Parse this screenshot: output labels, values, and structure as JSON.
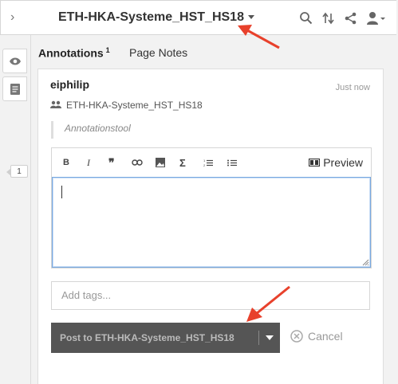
{
  "topbar": {
    "group_title": "ETH-HKA-Systeme_HST_HS18",
    "icons": [
      "search-icon",
      "sort-icon",
      "share-icon",
      "user-icon"
    ]
  },
  "sidebar": {
    "annotation_count": "1",
    "icons": [
      "eye-icon",
      "page-icon"
    ]
  },
  "tabs": {
    "annotations_label": "Annotations",
    "annotations_count": "1",
    "page_notes_label": "Page Notes"
  },
  "annotation": {
    "username": "eiphilip",
    "timestamp": "Just now",
    "group": "ETH-HKA-Systeme_HST_HS18",
    "quote": "Annotationstool"
  },
  "editor": {
    "toolbar": [
      "bold-icon",
      "italic-icon",
      "quote-icon",
      "link-icon",
      "image-icon",
      "math-icon",
      "numbered-list-icon",
      "bullet-list-icon"
    ],
    "preview_label": "Preview",
    "body_value": ""
  },
  "tags": {
    "placeholder": "Add tags..."
  },
  "actions": {
    "post_label": "Post to ETH-HKA-Systeme_HST_HS18",
    "cancel_label": "Cancel"
  },
  "colors": {
    "annotation_arrow": "#e8412c",
    "post_button": "#555555",
    "focus_border": "#79a9e0"
  }
}
